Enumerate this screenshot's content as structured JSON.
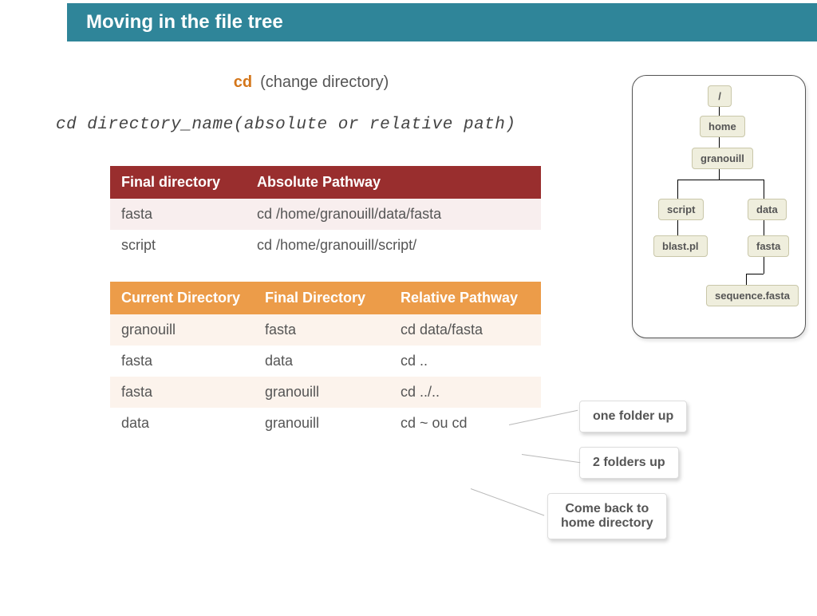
{
  "header": {
    "title": "Moving in the file tree"
  },
  "cmd": {
    "name": "cd",
    "desc": "(change directory)"
  },
  "syntax": "cd directory_name(absolute or relative path)",
  "tree": {
    "root": "/",
    "home": "home",
    "user": "granouill",
    "script": "script",
    "data": "data",
    "blast": "blast.pl",
    "fasta": "fasta",
    "seq": "sequence.fasta"
  },
  "table1": {
    "headers": [
      "Final directory",
      "Absolute Pathway"
    ],
    "rows": [
      {
        "dir": "fasta",
        "cmd": "cd /home/granouill/data/fasta"
      },
      {
        "dir": "script",
        "cmd": "cd /home/granouill/script/"
      }
    ]
  },
  "table2": {
    "headers": [
      "Current Directory",
      "Final Directory",
      "Relative Pathway"
    ],
    "rows": [
      {
        "cur": "granouill",
        "fin": "fasta",
        "cmd": "cd data/fasta"
      },
      {
        "cur": "fasta",
        "fin": "data",
        "cmd": "cd .."
      },
      {
        "cur": "fasta",
        "fin": "granouill",
        "cmd": "cd ../.."
      },
      {
        "cur": "data",
        "fin": "granouill",
        "cmd": "cd ~ ou cd"
      }
    ]
  },
  "callouts": {
    "one": "one folder up",
    "two": "2 folders up",
    "home": "Come back to\nhome directory"
  }
}
